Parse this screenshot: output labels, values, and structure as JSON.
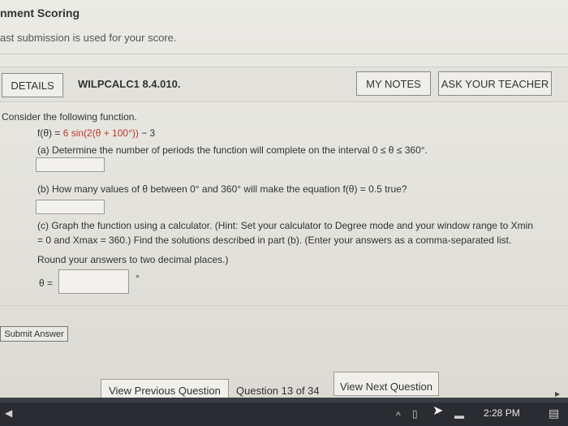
{
  "section": {
    "title": "nment Scoring",
    "subtitle": "ast submission is used for your score."
  },
  "header": {
    "details_label": "DETAILS",
    "question_id": "WILPCALC1 8.4.010.",
    "my_notes_label": "MY NOTES",
    "ask_teacher_label": "ASK YOUR TEACHER"
  },
  "question": {
    "intro": "Consider the following function.",
    "function_lhs": "f(θ) = ",
    "function_rhs_red": "6 sin(2(θ + 100°))",
    "function_tail": " − 3",
    "part_a": "(a) Determine the number of periods the function will complete on the interval  0 ≤ θ ≤ 360°.",
    "part_a_answer": "",
    "part_b": "(b) How many values of θ between 0° and 360° will make the equation  f(θ) = 0.5  true?",
    "part_b_answer": "",
    "part_c_line1": "(c) Graph the function using a calculator. (Hint: Set your calculator to Degree mode and your window range to Xmin",
    "part_c_line2": "= 0 and Xmax = 360.) Find the solutions described in part (b). (Enter your answers as a comma-separated list.",
    "part_c_line3": "Round your answers to two decimal places.)",
    "theta_label": "θ =",
    "theta_answer": "",
    "degree_unit": "°"
  },
  "submit_label": "Submit Answer",
  "nav": {
    "prev_label": "View Previous Question",
    "position": "Question 13 of 34",
    "next_label": "View Next Question"
  },
  "taskbar": {
    "clock": "2:28 PM"
  }
}
